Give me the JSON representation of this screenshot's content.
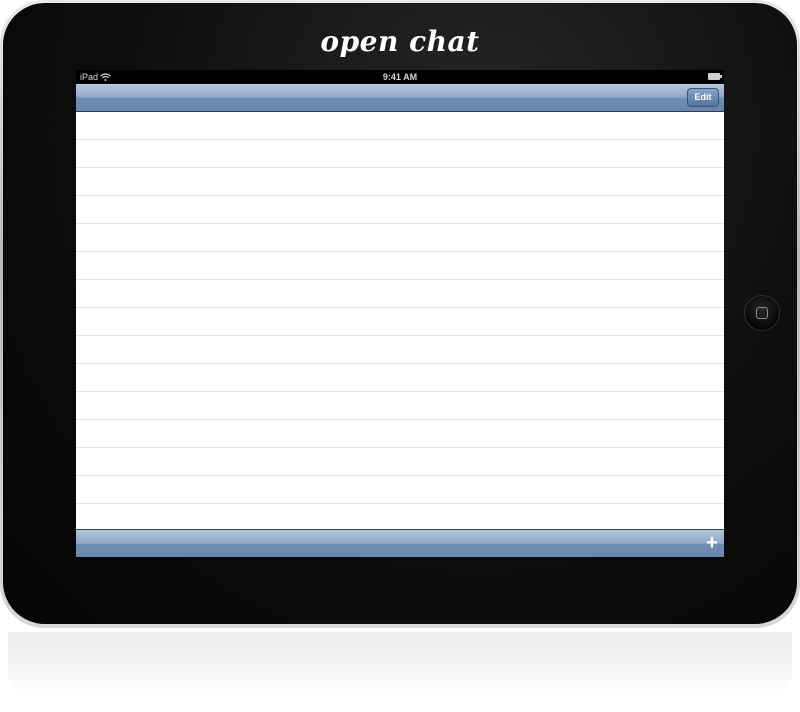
{
  "app": {
    "logo_text": "open chat"
  },
  "status_bar": {
    "device_label": "iPad",
    "time": "9:41 AM"
  },
  "nav_bar": {
    "title": "",
    "edit_label": "Edit"
  },
  "table": {
    "row_count": 15,
    "rows": []
  },
  "toolbar": {
    "add_label": "+"
  },
  "icons": {
    "wifi": "wifi-icon",
    "battery": "battery-icon",
    "home_button": "home-button-icon",
    "add": "plus-icon"
  },
  "colors": {
    "bar_accent": "#6f8db3",
    "bezel": "#0d0d0d"
  }
}
